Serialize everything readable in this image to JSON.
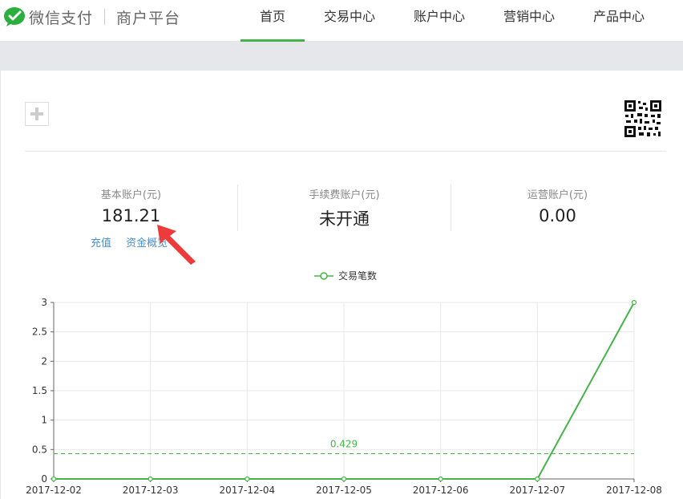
{
  "header": {
    "brand": "微信支付",
    "platform": "商户平台",
    "nav": [
      {
        "label": "首页",
        "active": true
      },
      {
        "label": "交易中心",
        "active": false
      },
      {
        "label": "账户中心",
        "active": false
      },
      {
        "label": "营销中心",
        "active": false
      },
      {
        "label": "产品中心",
        "active": false
      }
    ]
  },
  "accounts": [
    {
      "label": "基本账户(元)",
      "value": "181.21"
    },
    {
      "label": "手续费账户(元)",
      "value": "未开通"
    },
    {
      "label": "运营账户(元)",
      "value": "0.00"
    }
  ],
  "links": {
    "recharge": "充值",
    "overview": "资金概览"
  },
  "colors": {
    "accent": "#44b549",
    "link": "#4a90d0",
    "arrow": "#ee3a3a"
  },
  "chart_data": {
    "type": "line",
    "legend": "交易笔数",
    "legend_position": "top-center",
    "x": [
      "2017-12-02",
      "2017-12-03",
      "2017-12-04",
      "2017-12-05",
      "2017-12-06",
      "2017-12-07",
      "2017-12-08"
    ],
    "series": [
      {
        "name": "交易笔数",
        "values": [
          0,
          0,
          0,
          0,
          0,
          0,
          3
        ]
      }
    ],
    "ylim": [
      0,
      3
    ],
    "yticks": [
      "0",
      "0.5",
      "1",
      "1.5",
      "2",
      "2.5",
      "3"
    ],
    "average_line": {
      "value": 0.429,
      "label": "0.429"
    },
    "grid": true
  }
}
